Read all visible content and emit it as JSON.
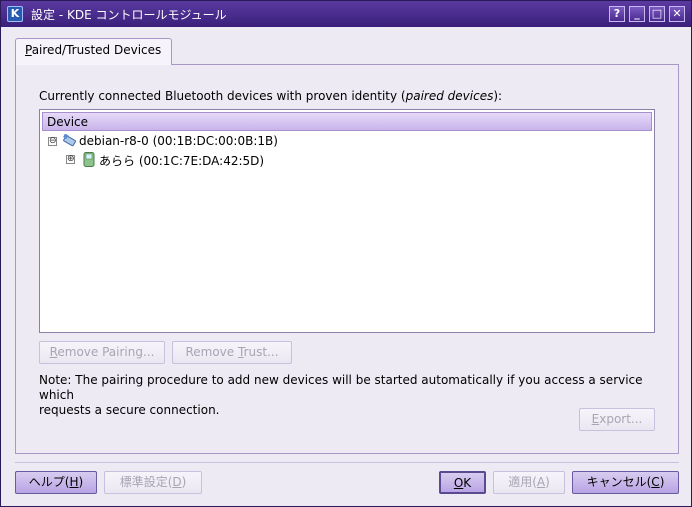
{
  "window": {
    "title": "設定 - KDE コントロールモジュール"
  },
  "titlebar_buttons": {
    "help": "?",
    "minimize": "_",
    "maximize": "□",
    "close": "✕"
  },
  "tab": {
    "label_prefix": "",
    "label_mnemonic": "P",
    "label_rest": "aired/Trusted Devices"
  },
  "content": {
    "desc_prefix": "Currently connected Bluetooth devices with proven identity (",
    "desc_italic": "paired devices",
    "desc_suffix": "):",
    "tree": {
      "column_header": "Device",
      "rows": [
        {
          "expander": "⊖",
          "label": "debian-r8-0 (00:1B:DC:00:0B:1B)",
          "icon": "usb-bluetooth-dongle-icon"
        },
        {
          "expander": "⊕",
          "label": "あらら (00:1C:7E:DA:42:5D)",
          "icon": "phone-icon"
        }
      ]
    },
    "remove_pairing": {
      "mn": "R",
      "rest": "emove Pairing..."
    },
    "remove_trust": {
      "pre": "Remove ",
      "mn": "T",
      "rest": "rust..."
    },
    "note_line1": "Note: The pairing procedure to add new devices will be started automatically if you access a service which",
    "note_line2": "requests a secure connection.",
    "export": {
      "mn": "E",
      "rest": "xport..."
    }
  },
  "footer": {
    "help": {
      "pre": "ヘルプ(",
      "mn": "H",
      "post": ")"
    },
    "defaults": {
      "pre": "標準設定(",
      "mn": "D",
      "post": ")"
    },
    "ok": {
      "mn": "O",
      "rest": "K"
    },
    "apply": {
      "pre": "適用(",
      "mn": "A",
      "post": ")"
    },
    "cancel": {
      "pre": "キャンセル(",
      "mn": "C",
      "post": ")"
    }
  }
}
